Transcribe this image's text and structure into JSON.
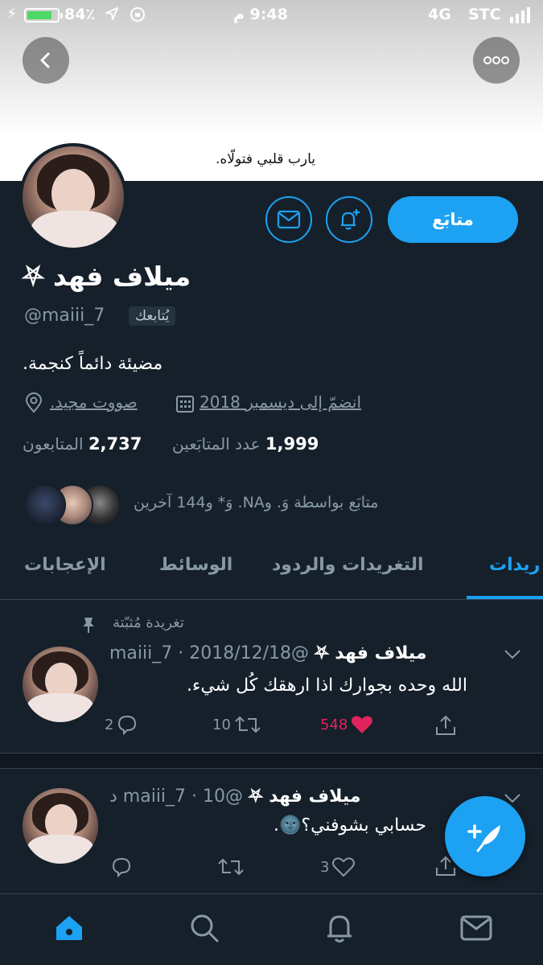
{
  "status_bar": {
    "battery": "84٪",
    "time": "9:48 م",
    "network": "4G",
    "carrier": "STC"
  },
  "banner": {
    "text": "يارب قلبي فتولّاه."
  },
  "profile": {
    "name": "ميلاف فهد ⛧",
    "handle": "@maiii_7",
    "follows_you": "يُتابعك",
    "bio": "مضيئة دائماً كنجمة.",
    "location": "صووت مجيد.",
    "joined": "انضمّ إلى ديسمبر 2018",
    "following_count": "1,999",
    "following_label": "عدد المتابَعين",
    "followers_count": "2,737",
    "followers_label": "المتابعون",
    "followed_by": "متابَع بواسطة وَ. وNA. وَ* و144 آخرين",
    "follow_button": "متابَع"
  },
  "tabs": [
    "ريدات",
    "التغريدات والردود",
    "الوسائط",
    "الإعجابات"
  ],
  "tweets": [
    {
      "pinned_label": "تغريدة مُثبّتة",
      "name": "ميلاف فهد ⛧",
      "handle_date": "@maiii_7 · 2018/12/18",
      "text": "الله وحده بجوارك اذا ارهقك كُل شيء.",
      "replies": "2",
      "retweets": "10",
      "likes": "548"
    },
    {
      "name": "ميلاف فهد ⛧",
      "handle_date": "@maiii_7 · 10 د",
      "text": "حسابي بشوفني؟🌚.",
      "replies": "",
      "retweets": "",
      "likes": "3"
    }
  ],
  "colors": {
    "accent": "#1da1f2",
    "background": "#15202b",
    "like": "#e0245e",
    "muted": "#8899a6"
  }
}
